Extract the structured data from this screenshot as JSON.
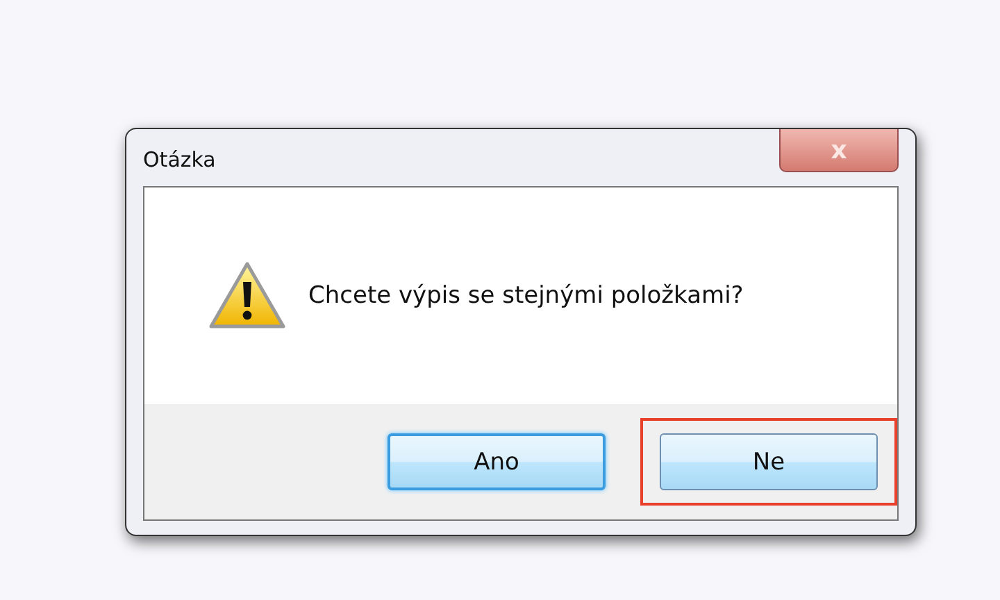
{
  "window": {
    "title": "Otázka",
    "close_label": "x"
  },
  "message": {
    "kind": "warning",
    "text": "Chcete výpis se stejnými položkami?"
  },
  "buttons": [
    {
      "label": "Ano",
      "default": true,
      "highlighted": false
    },
    {
      "label": "Ne",
      "default": false,
      "highlighted": true
    }
  ]
}
